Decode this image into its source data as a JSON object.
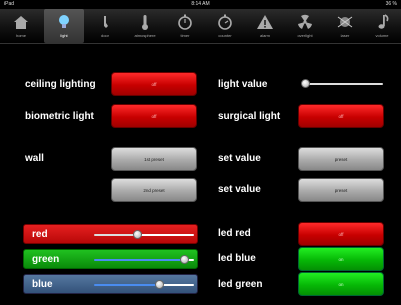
{
  "status": {
    "carrier": "iPad",
    "time": "8:14 AM",
    "battery": "36 %"
  },
  "tabs": [
    {
      "label": "home",
      "icon": "home-icon"
    },
    {
      "label": "light",
      "icon": "lightbulb-icon"
    },
    {
      "label": "door",
      "icon": "door-icon"
    },
    {
      "label": "atmosphere",
      "icon": "thermometer-icon"
    },
    {
      "label": "timer",
      "icon": "stopwatch-icon"
    },
    {
      "label": "counter",
      "icon": "stopwatch-icon"
    },
    {
      "label": "alarm",
      "icon": "warning-icon"
    },
    {
      "label": "overlight",
      "icon": "radiation-icon"
    },
    {
      "label": "laser",
      "icon": "laser-icon"
    },
    {
      "label": "volume",
      "icon": "music-note-icon"
    }
  ],
  "active_tab": 1,
  "controls": {
    "ceiling_lighting": {
      "label": "ceiling lighting",
      "button": "off"
    },
    "biometric_light": {
      "label": "biometric light",
      "button": "off"
    },
    "wall": {
      "label": "wall",
      "preset1": "1st preset",
      "preset2": "2nd preset"
    },
    "light_value": {
      "label": "light value",
      "level": 0.0
    },
    "surgical_light": {
      "label": "surgical light",
      "button": "off"
    },
    "set_value_1": {
      "label": "set value",
      "button": "preset"
    },
    "set_value_2": {
      "label": "set value",
      "button": "preset"
    }
  },
  "rgb": {
    "red": {
      "label": "red",
      "level": 0.43
    },
    "green": {
      "label": "green",
      "level": 0.9
    },
    "blue": {
      "label": "blue",
      "level": 0.65
    }
  },
  "leds": {
    "red": {
      "label": "led red",
      "button": "off"
    },
    "blue": {
      "label": "led blue",
      "button": "on"
    },
    "green": {
      "label": "led green",
      "button": "on"
    }
  },
  "colors": {
    "red_button": "#e00000",
    "green_button": "#0cc00c",
    "gray_button": "#bbbbbb",
    "red_row": "#c81010",
    "green_row": "#10a010",
    "blue_row": "#3c5f88"
  }
}
